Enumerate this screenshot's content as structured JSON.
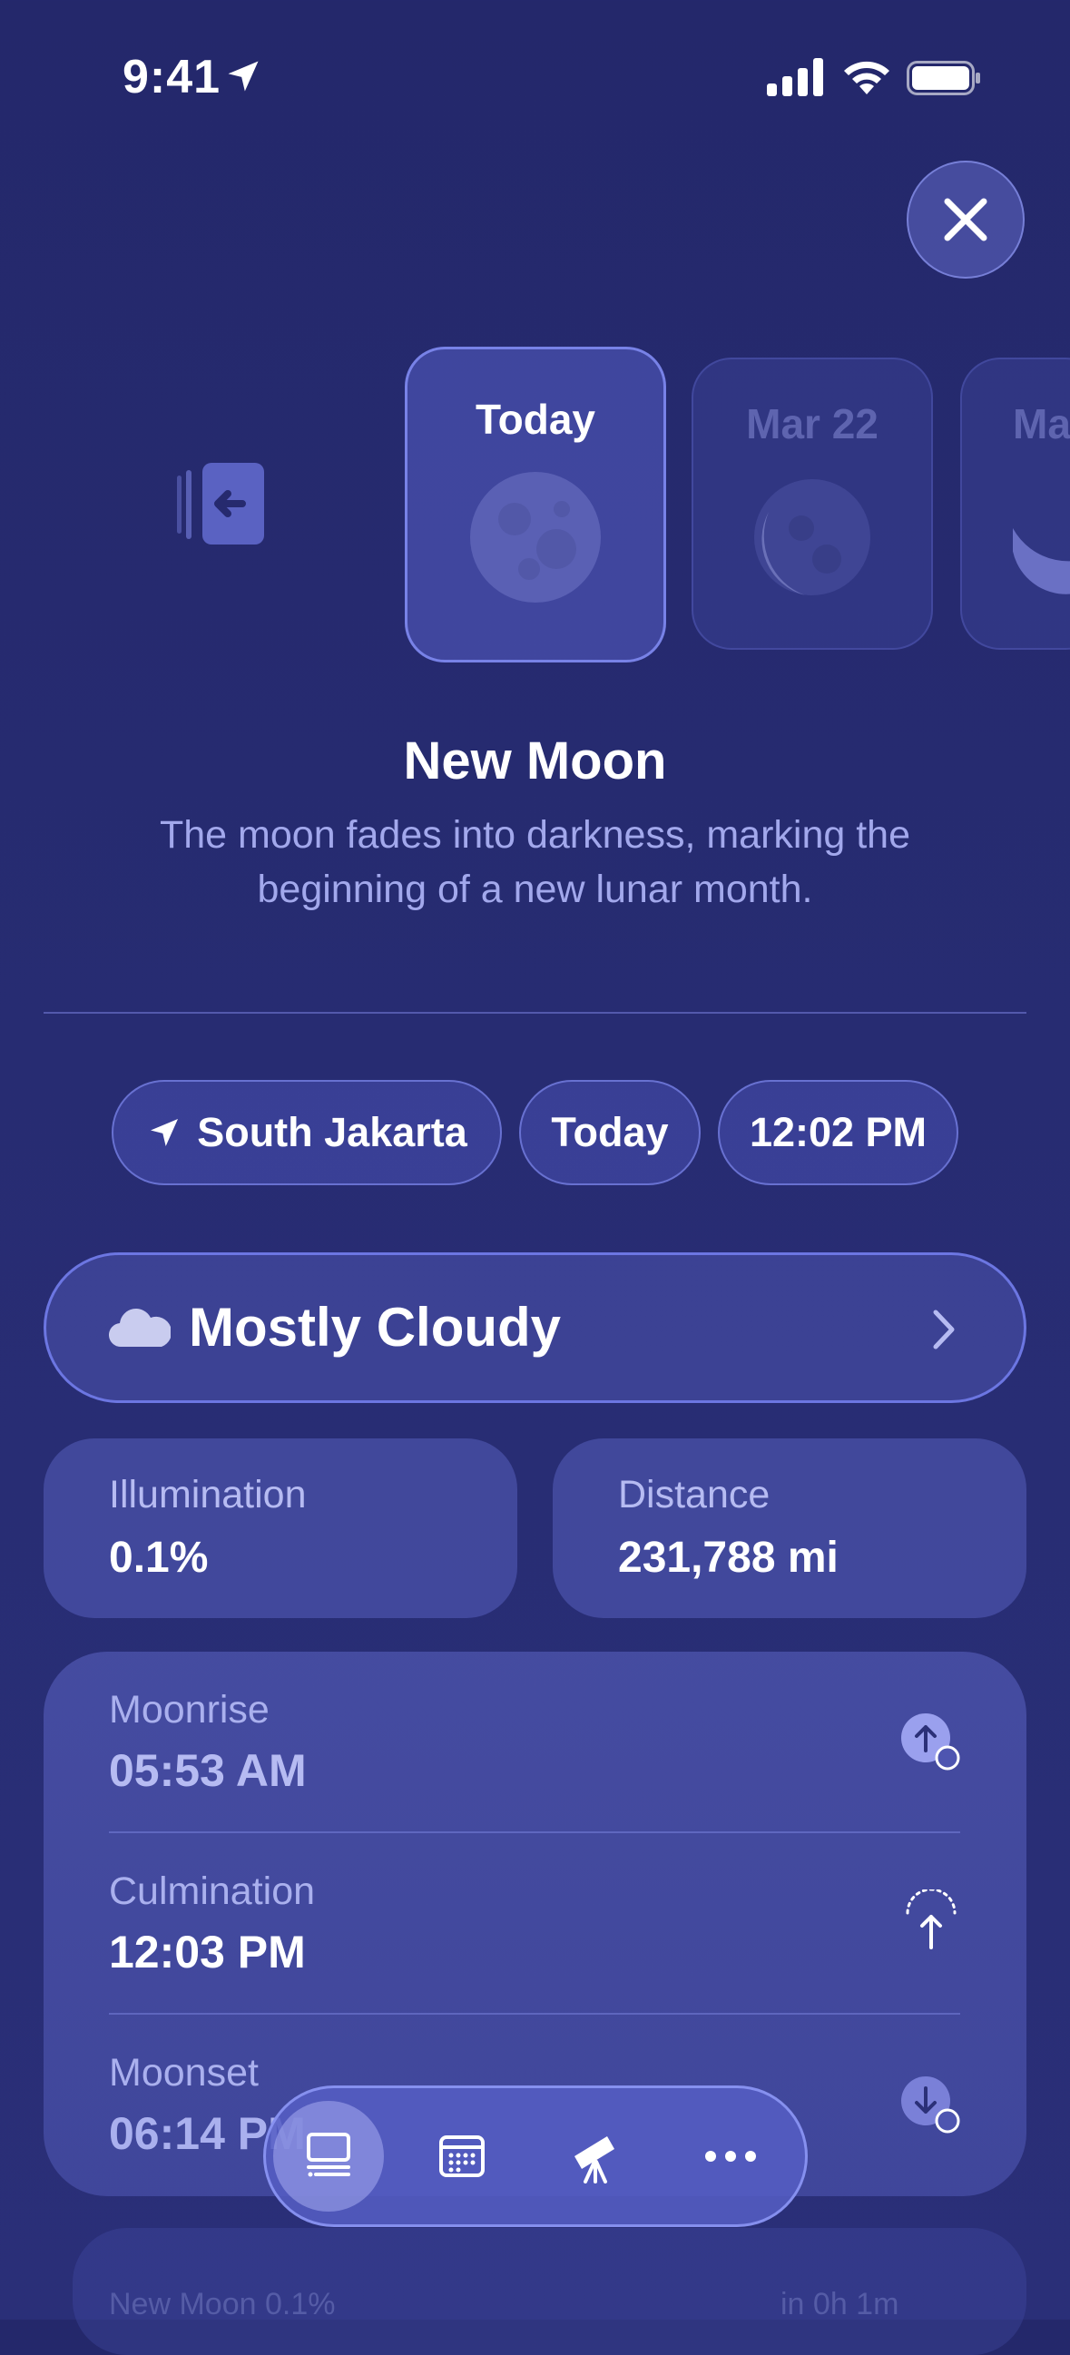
{
  "status_bar": {
    "time": "9:41"
  },
  "carousel": {
    "cards": [
      {
        "label": "Today"
      },
      {
        "label": "Mar 22"
      },
      {
        "label": "Ma"
      }
    ]
  },
  "phase": {
    "title": "New Moon",
    "description": "The moon fades into darkness, marking the beginning of a new lunar month."
  },
  "chips": {
    "location": "South Jakarta",
    "date": "Today",
    "time": "12:02 PM"
  },
  "weather": {
    "label": "Mostly Cloudy",
    "icon": "cloud-icon"
  },
  "stats": {
    "illumination_label": "Illumination",
    "illumination_value": "0.1%",
    "distance_label": "Distance",
    "distance_value": "231,788 mi"
  },
  "events": {
    "moonrise_label": "Moonrise",
    "moonrise_value": "05:53 AM",
    "culmination_label": "Culmination",
    "culmination_value": "12:03 PM",
    "moonset_label": "Moonset",
    "moonset_value": "06:14 PM"
  },
  "peek": {
    "left": "New Moon 0.1%",
    "right": "in 0h 1m"
  },
  "tabbar": {
    "tabs": [
      {
        "name": "list-tab",
        "icon": "list-icon",
        "active": true
      },
      {
        "name": "calendar-tab",
        "icon": "calendar-icon",
        "active": false
      },
      {
        "name": "telescope-tab",
        "icon": "telescope-icon",
        "active": false
      },
      {
        "name": "more-tab",
        "icon": "ellipsis-icon",
        "active": false
      }
    ]
  }
}
